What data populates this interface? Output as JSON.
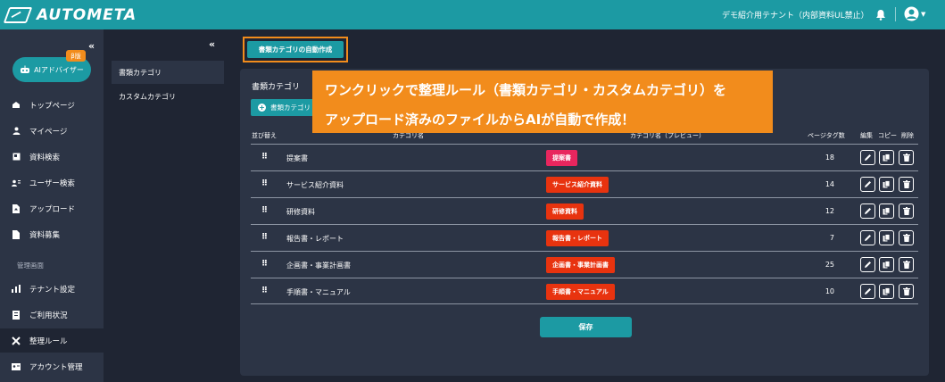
{
  "header": {
    "logo_text": "AUTOMETA",
    "tenant": "デモ紹介用テナント（内部資料UL禁止）"
  },
  "sidebar": {
    "ai_button": "AIアドバイザー",
    "beta_badge": "β版",
    "items": [
      {
        "label": "トップページ",
        "icon": "home-icon"
      },
      {
        "label": "マイページ",
        "icon": "person-icon"
      },
      {
        "label": "資料検索",
        "icon": "document-search-icon"
      },
      {
        "label": "ユーザー検索",
        "icon": "user-search-icon"
      },
      {
        "label": "アップロード",
        "icon": "upload-icon"
      },
      {
        "label": "資料募集",
        "icon": "document-icon"
      }
    ],
    "section_label": "管理画面",
    "admin_items": [
      {
        "label": "テナント設定",
        "icon": "bar-chart-icon"
      },
      {
        "label": "ご利用状況",
        "icon": "usage-icon"
      },
      {
        "label": "整理ルール",
        "icon": "tools-icon"
      },
      {
        "label": "アカウント管理",
        "icon": "id-card-icon"
      }
    ]
  },
  "subnav": {
    "items": [
      "書類カテゴリ",
      "カスタムカテゴリ"
    ]
  },
  "main": {
    "auto_create_button": "書類カテゴリの自動作成",
    "panel_title": "書類カテゴリ",
    "add_button": "書類カテゴリ",
    "columns": {
      "sort": "並び替え",
      "name": "カテゴリ名",
      "preview": "カテゴリ名（プレビュー）",
      "tag_count": "ページタグ数",
      "edit": "編集",
      "copy": "コピー",
      "delete": "削除"
    },
    "rows": [
      {
        "name": "提案書",
        "preview": "提案書",
        "count": "18",
        "color": "#e8265e"
      },
      {
        "name": "サービス紹介資料",
        "preview": "サービス紹介資料",
        "count": "14",
        "color": "#e8330f"
      },
      {
        "name": "研修資料",
        "preview": "研修資料",
        "count": "12",
        "color": "#e8330f"
      },
      {
        "name": "報告書・レポート",
        "preview": "報告書・レポート",
        "count": "7",
        "color": "#e8330f"
      },
      {
        "name": "企画書・事業計画書",
        "preview": "企画書・事業計画書",
        "count": "25",
        "color": "#e8330f"
      },
      {
        "name": "手順書・マニュアル",
        "preview": "手順書・マニュアル",
        "count": "10",
        "color": "#e8330f"
      }
    ],
    "save_button": "保存"
  },
  "callout": {
    "line1": "ワンクリックで整理ルール（書類カテゴリ・カスタムカテゴリ）を",
    "line2": "アップロード済みのファイルからAIが自動で作成！"
  },
  "colors": {
    "accent": "#1c9aa3",
    "highlight": "#f28c1c",
    "sidebar_bg": "#2c3445",
    "page_bg": "#1f2533"
  }
}
